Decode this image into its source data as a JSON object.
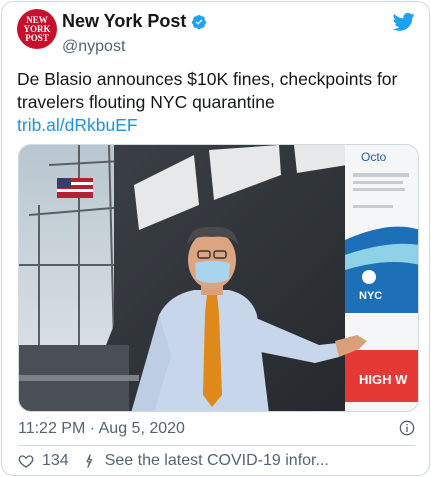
{
  "account": {
    "avatar_text_lines": [
      "NEW",
      "YORK",
      "POST"
    ],
    "name": "New York Post",
    "handle": "@nypost",
    "verified_icon": "verified-badge-icon"
  },
  "tweet": {
    "text": "De Blasio announces $10K fines, checkpoints for travelers flouting NYC quarantine",
    "link": "trib.al/dRkbuEF"
  },
  "media": {
    "sign_text_top": "Octo",
    "sign_logo": "NYC",
    "sign_banner": "HIGH W"
  },
  "footer": {
    "timestamp": "11:22 PM · Aug 5, 2020",
    "like_count": "134",
    "info_link": "See the latest COVID-19 infor..."
  },
  "colors": {
    "brand_red": "#c8102e",
    "link_blue": "#1b95e0",
    "verified_blue": "#1da1f2",
    "secondary_text": "#536471"
  }
}
